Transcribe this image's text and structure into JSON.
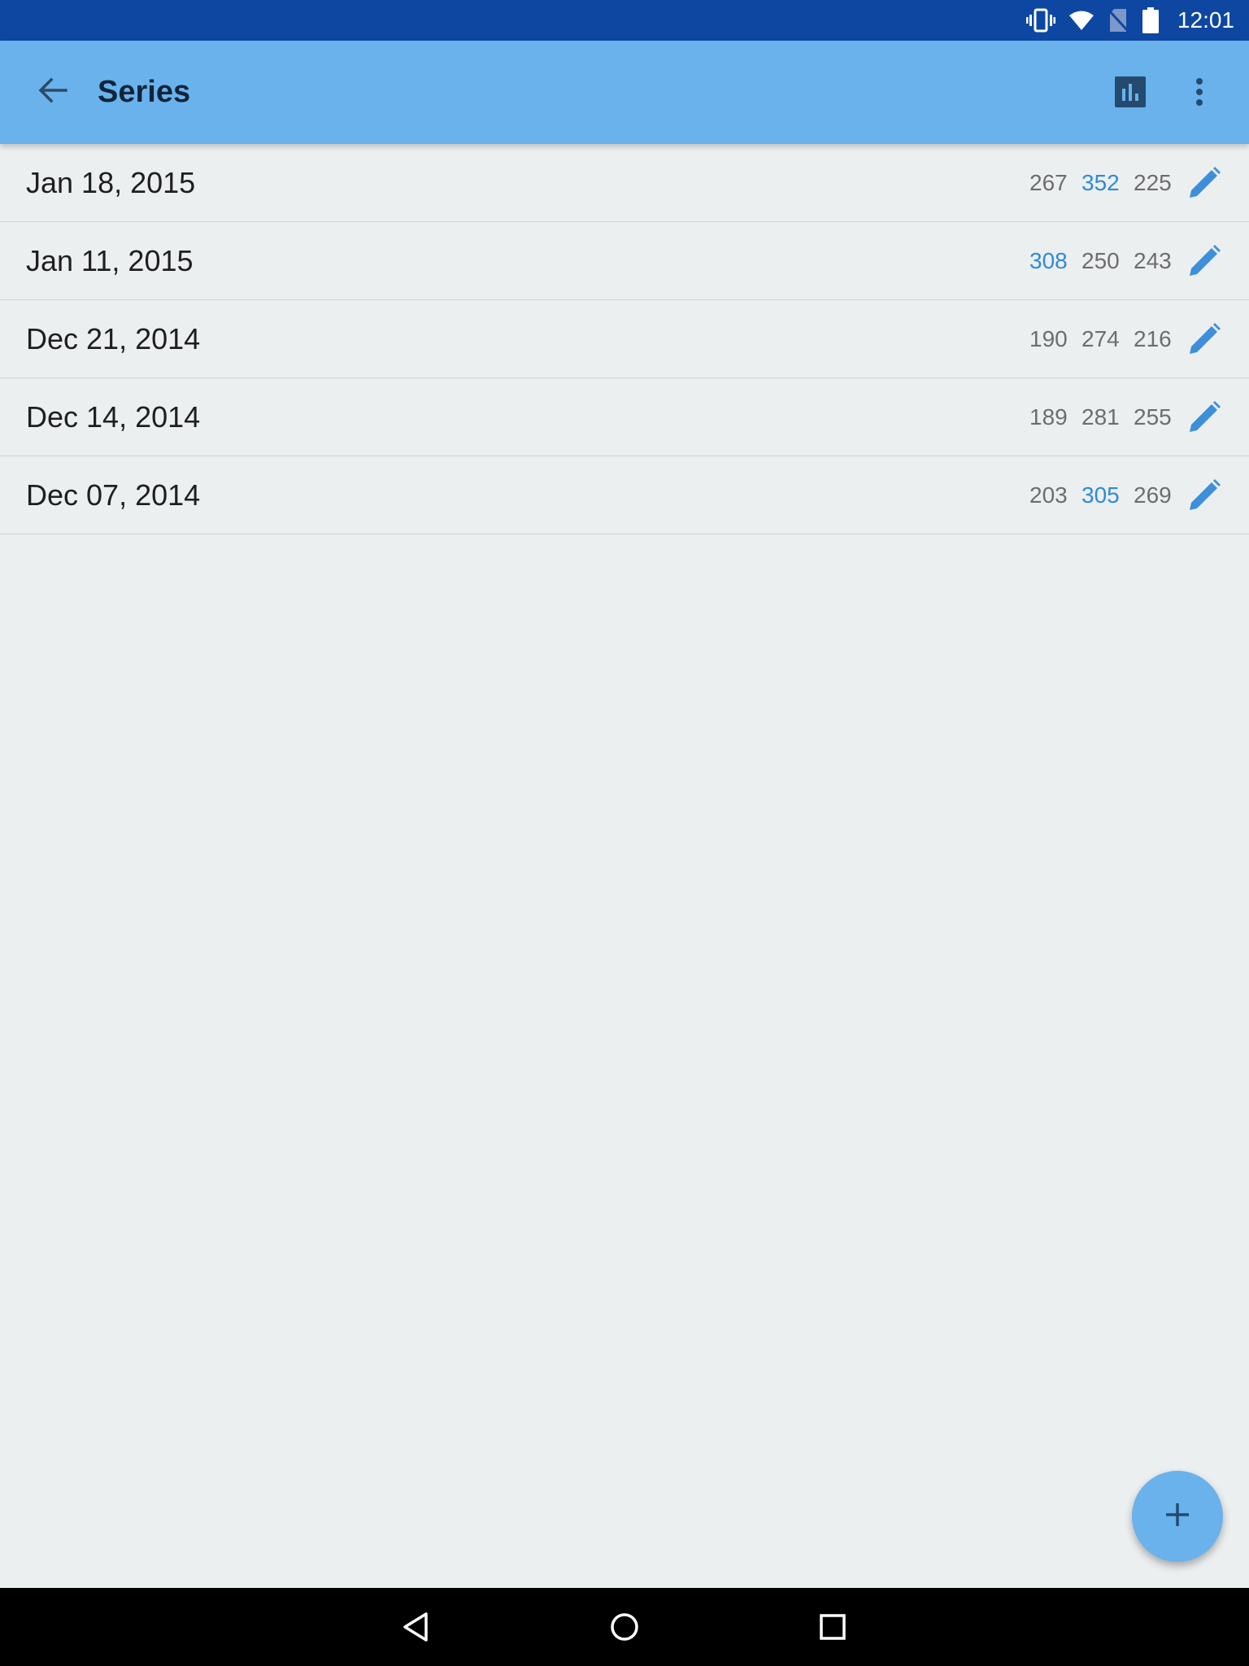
{
  "status_bar": {
    "time": "12:01",
    "icons": [
      "vibrate-icon",
      "wifi-icon",
      "no-sim-icon",
      "battery-icon"
    ],
    "background": "#0D47A1"
  },
  "app_bar": {
    "title": "Series",
    "background": "#69B2EC",
    "back_icon": "arrow-back-icon",
    "chart_icon": "bar-chart-icon",
    "more_icon": "more-vert-icon"
  },
  "series": [
    {
      "date": "Jan 18, 2015",
      "scores": [
        "267",
        "352",
        "225"
      ],
      "highlight": 1
    },
    {
      "date": "Jan 11, 2015",
      "scores": [
        "308",
        "250",
        "243"
      ],
      "highlight": 0
    },
    {
      "date": "Dec 21, 2014",
      "scores": [
        "190",
        "274",
        "216"
      ],
      "highlight": -1
    },
    {
      "date": "Dec 14, 2014",
      "scores": [
        "189",
        "281",
        "255"
      ],
      "highlight": -1
    },
    {
      "date": "Dec 07, 2014",
      "scores": [
        "203",
        "305",
        "269"
      ],
      "highlight": 1
    }
  ],
  "colors": {
    "accent": "#2F8AD8",
    "score_normal": "#6D6D6D",
    "fab": "#69B2EC"
  },
  "fab": {
    "icon": "plus-icon"
  },
  "nav_bar": {
    "icons": [
      "back-triangle-icon",
      "home-circle-icon",
      "recents-square-icon"
    ]
  }
}
